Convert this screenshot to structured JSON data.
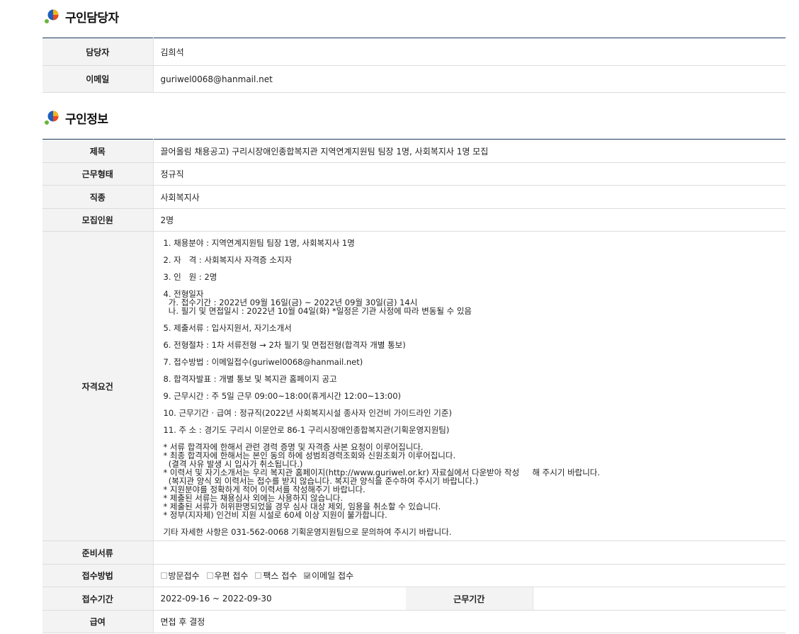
{
  "recruiter": {
    "section_title": "구인담당자",
    "rows": [
      {
        "label": "담당자",
        "value": "김희석"
      },
      {
        "label": "이메일",
        "value": "guriwel0068@hanmail.net"
      }
    ]
  },
  "job": {
    "section_title": "구인정보",
    "title_label": "제목",
    "title_value": "끌어올림 채용공고) 구리시장애인종합복지관 지역연계지원팀 팀장 1명, 사회복지사 1명 모집",
    "type_label": "근무형태",
    "type_value": "정규직",
    "category_label": "직종",
    "category_value": "사회복지사",
    "headcount_label": "모집인원",
    "headcount_value": "2명",
    "qualification_label": "자격요건",
    "qualification_lines": [
      "1. 채용분야 : 지역연계지원팀 팀장 1명, 사회복지사 1명",
      "2. 자   격 : 사회복지사 자격증 소지자",
      "3. 인   원 : 2명",
      "4. 전형일자",
      "  가. 접수기간 : 2022년 09월 16일(금) ~ 2022년 09월 30일(금) 14시",
      "  나. 필기 및 면접일시 : 2022년 10월 04일(화) *일정은 기관 사정에 따라 변동될 수 있음",
      "5. 제출서류 : 입사지원서, 자기소개서",
      "6. 전형절차 : 1차 서류전형 → 2차 필기 및 면접전형(합격자 개별 통보)",
      "7. 접수방법 : 이메일접수(guriwel0068@hanmail.net)",
      "8. 합격자발표 : 개별 통보 및 복지관 홈페이지 공고",
      "9. 근무시간 : 주 5일 근무 09:00~18:00(휴게시간 12:00~13:00)",
      "10. 근무기간 · 급여 : 정규직(2022년 사회복지시설 종사자 인건비 가이드라인 기준)",
      "11. 주 소 : 경기도 구리시 이문안로 86-1 구리시장애인종합복지관(기획운영지원팀)",
      "* 서류 합격자에 한해서 관련 경력 증명 및 자격증 사본 요청이 이루어집니다.",
      "* 최종 합격자에 한해서는 본인 동의 하에 성범죄경력조회와 신원조회가 이루어집니다.",
      "  (결격 사유 발생 시 입사가 취소됩니다.)",
      "* 이력서 및 자기소개서는 우리 복지관 홈페이지(http://www.guriwel.or.kr) 자료실에서 다운받아 작성     해 주시기 바랍니다.",
      "  (복지관 양식 외 이력서는 접수를 받지 않습니다. 복지관 양식을 준수하여 주시기 바랍니다.)",
      "* 지원분야를 정확하게 적어 이력서를 작성해주기 바랍니다.",
      "* 제출된 서류는 채용심사 외에는 사용하지 않습니다.",
      "* 제출된 서류가 허위판명되었을 경우 심사 대상 제외, 임용을 취소할 수 있습니다.",
      "* 정부(지자체) 인건비 지원 시설로 60세 이상 지원이 불가합니다.",
      "기타 자세한 사항은 031-562-0068 기획운영지원팀으로 문의하여 주시기 바랍니다."
    ],
    "documents_label": "준비서류",
    "documents_value": "",
    "apply_method_label": "접수방법",
    "apply_options": [
      {
        "label": "방문접수",
        "checked": false
      },
      {
        "label": "우편 접수",
        "checked": false
      },
      {
        "label": "팩스 접수",
        "checked": false
      },
      {
        "label": "이메일 접수",
        "checked": true
      }
    ],
    "apply_period_label": "접수기간",
    "apply_period_value": "2022-09-16 ~ 2022-09-30",
    "work_period_label": "근무기간",
    "work_period_value": "",
    "salary_label": "급여",
    "salary_value": "면접 후 결정"
  }
}
